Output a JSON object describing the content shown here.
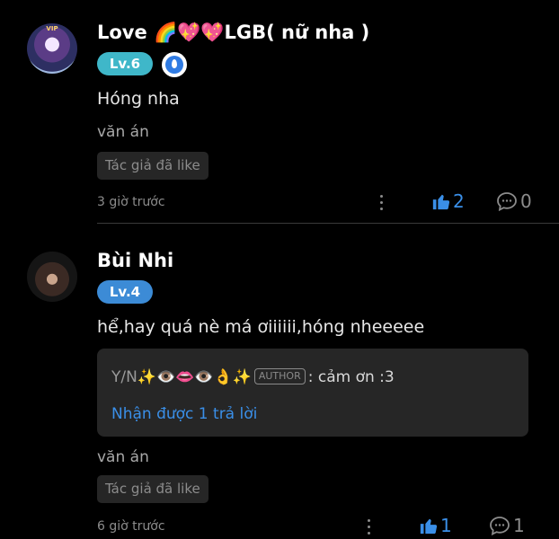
{
  "comments": [
    {
      "avatar_badge": "VIP",
      "name": "Love 🌈💖💖LGB( nữ nha )",
      "level": "Lv.6",
      "vip_icon": "vip-droplet-icon",
      "text": "Hóng nha",
      "tag": "văn án",
      "liked_label": "Tác giả đã like",
      "time": "3 giờ trước",
      "likes": "2",
      "replies": "0"
    },
    {
      "name": "Bùi Nhi",
      "level": "Lv.4",
      "text": "hể,hay quá nè má ơiiiiii,hóng nheeeee",
      "reply": {
        "author_name": "Y/N✨👁️👄👁️👌✨",
        "author_tag": "AUTHOR",
        "text": ": cảm ơn :3",
        "link": "Nhận được 1 trả lời"
      },
      "tag": "văn án",
      "liked_label": "Tác giả đã like",
      "time": "6 giờ trước",
      "likes": "1",
      "replies": "1"
    }
  ],
  "colors": {
    "background": "#000000",
    "accent_blue": "#3a8fe8",
    "level6": "#3fb7c9",
    "level4": "#3c8bd6"
  }
}
